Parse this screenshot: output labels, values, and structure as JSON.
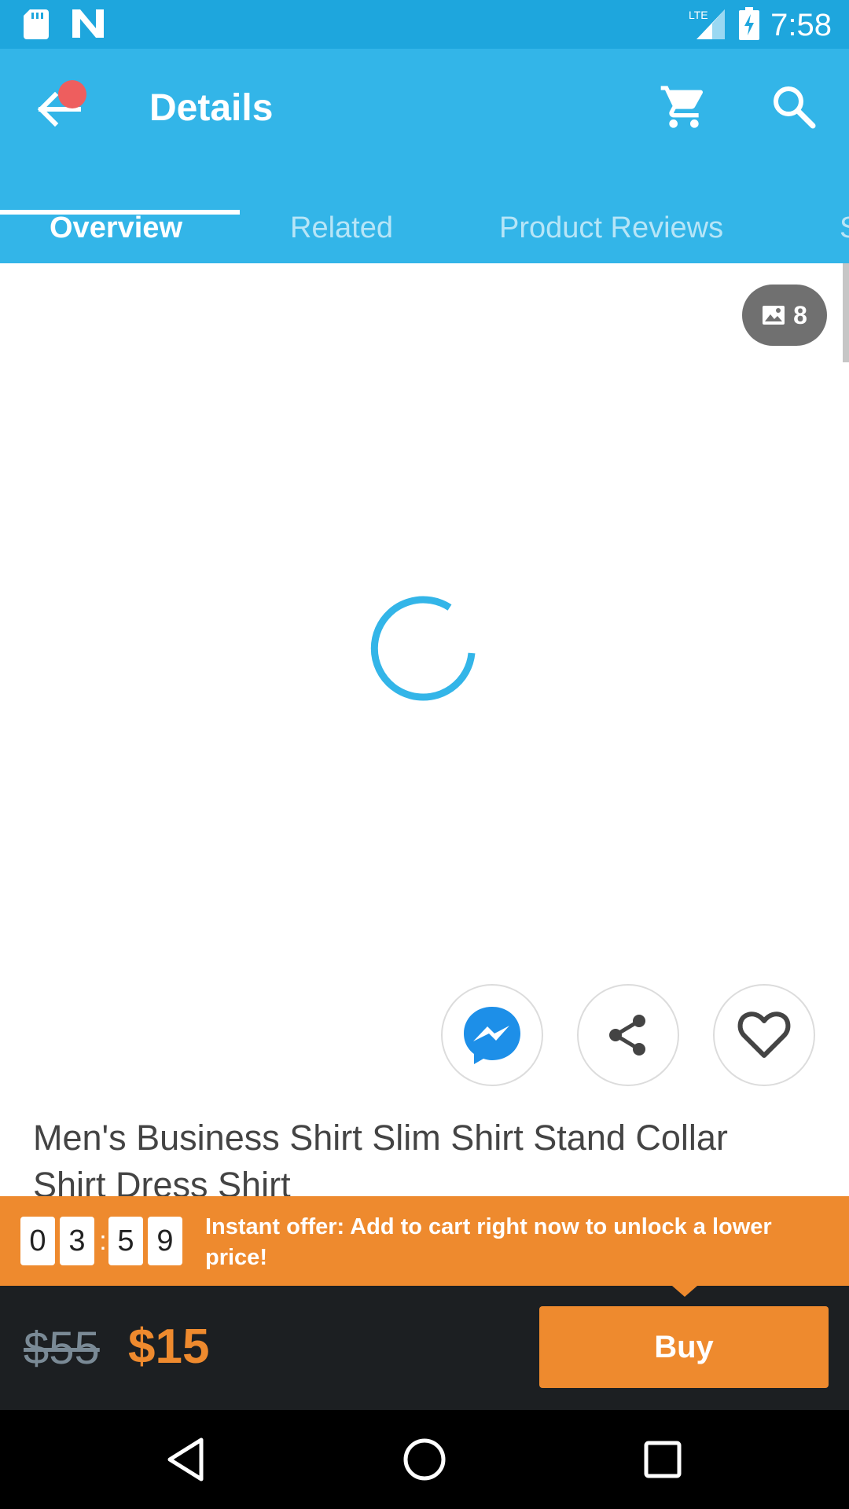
{
  "status_bar": {
    "time": "7:58",
    "network": "LTE"
  },
  "app_bar": {
    "title": "Details"
  },
  "tabs": [
    {
      "label": "Overview",
      "active": true
    },
    {
      "label": "Related",
      "active": false
    },
    {
      "label": "Product Reviews",
      "active": false
    },
    {
      "label": "S",
      "active": false
    }
  ],
  "gallery": {
    "photo_count": "8"
  },
  "product": {
    "title": "Men's Business Shirt Slim Shirt Stand Collar Shirt Dress Shirt"
  },
  "offer": {
    "timer_digits": [
      "0",
      "3",
      "5",
      "9"
    ],
    "text": "Instant offer: Add to cart right now to unlock a lower price!"
  },
  "pricing": {
    "old_price": "$55",
    "new_price": "$15",
    "buy_label": "Buy"
  },
  "colors": {
    "primary": "#33b5e8",
    "status_bar": "#1ea6dd",
    "accent": "#ee8a2e",
    "dark_bar": "#1c1f22"
  }
}
